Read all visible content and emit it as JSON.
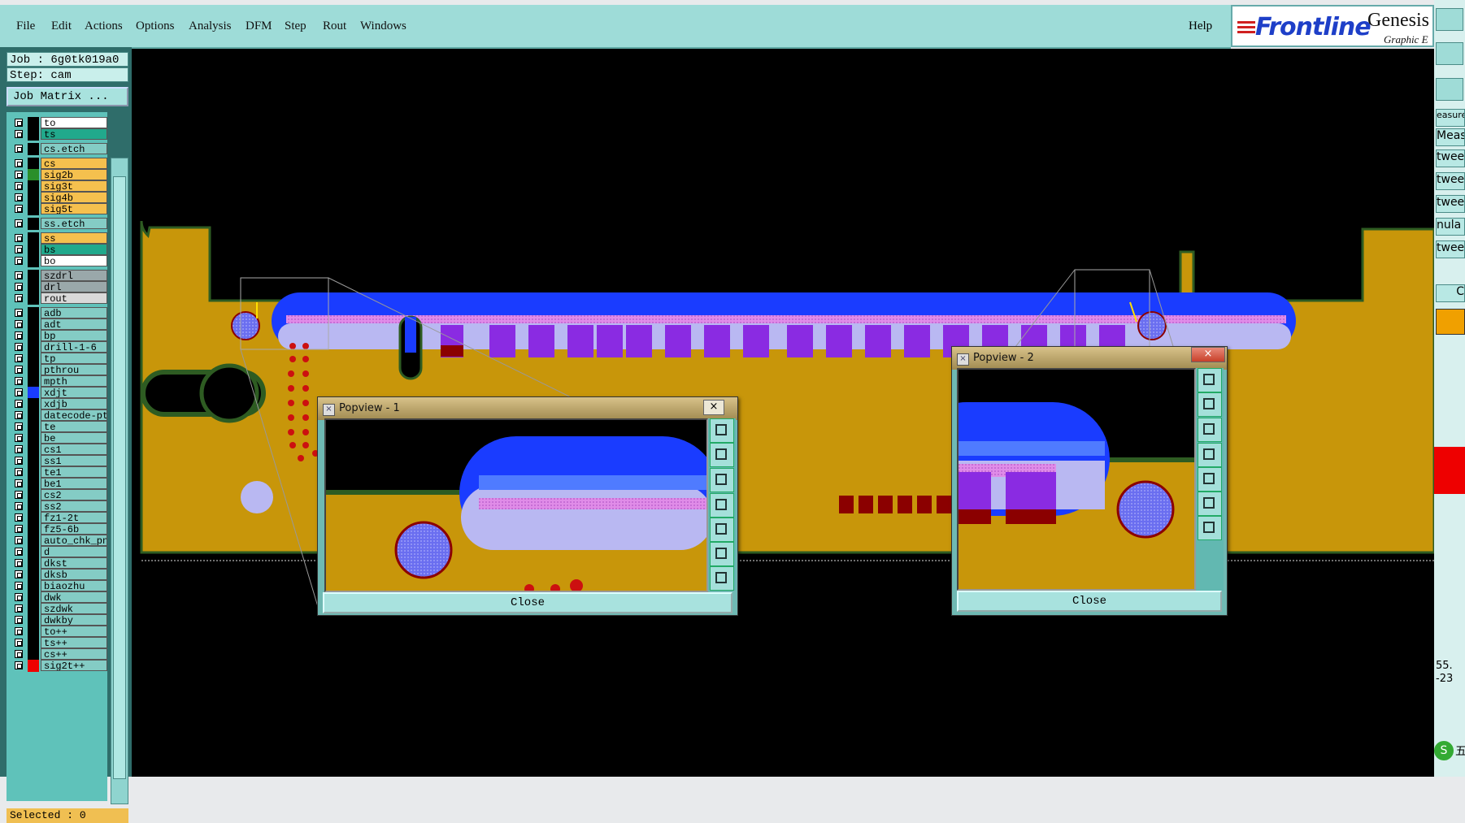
{
  "menu": {
    "items": [
      "File",
      "Edit",
      "Actions",
      "Options",
      "Analysis",
      "DFM",
      "Step",
      "Rout",
      "Windows"
    ],
    "help": "Help"
  },
  "logo": {
    "brand": "Frontline",
    "product": "Genesis",
    "subtitle": "Graphic E"
  },
  "job": {
    "job_line": "Job : 6g0tk019a0",
    "step_line": "Step: cam",
    "matrix_button": "Job Matrix ..."
  },
  "layers": [
    {
      "name": "to",
      "color": "#ffffff"
    },
    {
      "name": "ts",
      "color": "#21a98c"
    },
    {
      "name": "cs.etch",
      "color": "#84ccc5"
    },
    {
      "name": "cs",
      "color": "#f5c04e"
    },
    {
      "name": "sig2b",
      "color": "#f5c04e"
    },
    {
      "name": "sig3t",
      "color": "#f5c04e"
    },
    {
      "name": "sig4b",
      "color": "#f5c04e"
    },
    {
      "name": "sig5t",
      "color": "#f5c04e"
    },
    {
      "name": "ss.etch",
      "color": "#84ccc5"
    },
    {
      "name": "ss",
      "color": "#f5c04e"
    },
    {
      "name": "bs",
      "color": "#21a98c"
    },
    {
      "name": "bo",
      "color": "#ffffff"
    },
    {
      "name": "szdrl",
      "color": "#9aa8aa"
    },
    {
      "name": "drl",
      "color": "#9aa8aa"
    },
    {
      "name": "rout",
      "color": "#d9d9d9"
    },
    {
      "name": "adb",
      "color": "#84ccc5"
    },
    {
      "name": "adt",
      "color": "#84ccc5"
    },
    {
      "name": "bp",
      "color": "#84ccc5"
    },
    {
      "name": "drill-1-6",
      "color": "#84ccc5"
    },
    {
      "name": "tp",
      "color": "#84ccc5"
    },
    {
      "name": "pthrou",
      "color": "#84ccc5"
    },
    {
      "name": "mpth",
      "color": "#84ccc5"
    },
    {
      "name": "xdjt",
      "color": "#84ccc5"
    },
    {
      "name": "xdjb",
      "color": "#84ccc5"
    },
    {
      "name": "datecode-pto",
      "color": "#84ccc5"
    },
    {
      "name": "te",
      "color": "#84ccc5"
    },
    {
      "name": "be",
      "color": "#84ccc5"
    },
    {
      "name": "cs1",
      "color": "#84ccc5"
    },
    {
      "name": "ss1",
      "color": "#84ccc5"
    },
    {
      "name": "te1",
      "color": "#84ccc5"
    },
    {
      "name": "be1",
      "color": "#84ccc5"
    },
    {
      "name": "cs2",
      "color": "#84ccc5"
    },
    {
      "name": "ss2",
      "color": "#84ccc5"
    },
    {
      "name": "fz1-2t",
      "color": "#84ccc5"
    },
    {
      "name": "fz5-6b",
      "color": "#84ccc5"
    },
    {
      "name": "auto_chk_pn..",
      "color": "#84ccc5"
    },
    {
      "name": "d",
      "color": "#84ccc5"
    },
    {
      "name": "dkst",
      "color": "#84ccc5"
    },
    {
      "name": "dksb",
      "color": "#84ccc5"
    },
    {
      "name": "biaozhu",
      "color": "#84ccc5"
    },
    {
      "name": "dwk",
      "color": "#84ccc5"
    },
    {
      "name": "szdwk",
      "color": "#84ccc5"
    },
    {
      "name": "dwkby",
      "color": "#84ccc5"
    },
    {
      "name": "to++",
      "color": "#84ccc5"
    },
    {
      "name": "ts++",
      "color": "#84ccc5"
    },
    {
      "name": "cs++",
      "color": "#84ccc5"
    },
    {
      "name": "sig2t++",
      "color": "#84ccc5"
    }
  ],
  "status": {
    "selected": "Selected : 0"
  },
  "popview1": {
    "title": "Popview - 1",
    "close": "Close",
    "x": "×"
  },
  "popview2": {
    "title": "Popview - 2",
    "close": "Close",
    "x": "×"
  },
  "right_strip": {
    "labels": [
      "easure",
      "Measu",
      "twee",
      "twee",
      "twee",
      "nula",
      "twee",
      "C"
    ],
    "readout": [
      "55.",
      "-23"
    ],
    "ime": "五"
  },
  "colors": {
    "board": "#c8960a",
    "copper_blue": "#1a3cff",
    "pad_purple": "#8a2be2",
    "pad_red": "#8b0000",
    "drill_red": "#cc1010",
    "lilac": "#b9b8f2"
  }
}
